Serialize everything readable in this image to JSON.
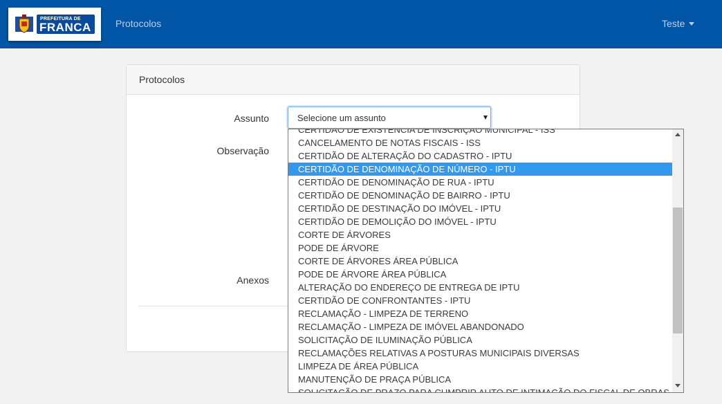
{
  "navbar": {
    "logo_small": "PREFEITURA DE",
    "logo_big": "FRANCA",
    "link": "Protocolos",
    "user": "Teste"
  },
  "card": {
    "title": "Protocolos",
    "labels": {
      "assunto": "Assunto",
      "observacao": "Observação",
      "anexos": "Anexos"
    }
  },
  "select": {
    "value": "Selecione um assunto"
  },
  "dropdown": {
    "selected_index": 3,
    "options": [
      "CERTIDÃO DE EXISTÊNCIA DE INSCRIÇÃO MUNICIPAL - ISS",
      "CANCELAMENTO DE NOTAS FISCAIS - ISS",
      "CERTIDÃO DE ALTERAÇÃO DO CADASTRO - IPTU",
      "CERTIDÃO DE DENOMINAÇÃO DE NÚMERO - IPTU",
      "CERTIDÃO DE DENOMINAÇÃO DE RUA - IPTU",
      "CERTIDÃO DE DENOMINAÇÃO DE BAIRRO - IPTU",
      "CERTIDÃO DE DESTINAÇÃO DO IMÓVEL - IPTU",
      "CERTIDÃO DE DEMOLIÇÃO DO IMÓVEL - IPTU",
      "CORTE DE ÁRVORES",
      "PODE DE ÁRVORE",
      "CORTE DE ÁRVORES ÁREA PÚBLICA",
      "PODE DE ÁRVORE ÁREA PÚBLICA",
      "ALTERAÇÃO DO ENDEREÇO DE ENTREGA DE IPTU",
      "CERTIDÃO DE CONFRONTANTES - IPTU",
      "RECLAMAÇÃO - LIMPEZA DE TERRENO",
      "RECLAMAÇÃO - LIMPEZA DE IMÓVEL ABANDONADO",
      "SOLICITAÇÃO DE ILUMINAÇÃO PÚBLICA",
      "RECLAMAÇÕES RELATIVAS A POSTURAS MUNICIPAIS DIVERSAS",
      "LIMPEZA DE ÁREA PÚBLICA",
      "MANUTENÇÃO DE PRAÇA PÚBLICA",
      "SOLICITAÇÃO DE PRAZO PARA CUMPRIR AUTO DE INTIMAÇÃO DO FISCAL DE OBRAS"
    ]
  },
  "colors": {
    "navbar": "#0055a6",
    "selected_option": "#3399ee"
  },
  "icons": {
    "dropdown_arrow": "chevron-down-icon",
    "user_caret": "caret-down-icon",
    "crest": "coat-of-arms-icon"
  }
}
